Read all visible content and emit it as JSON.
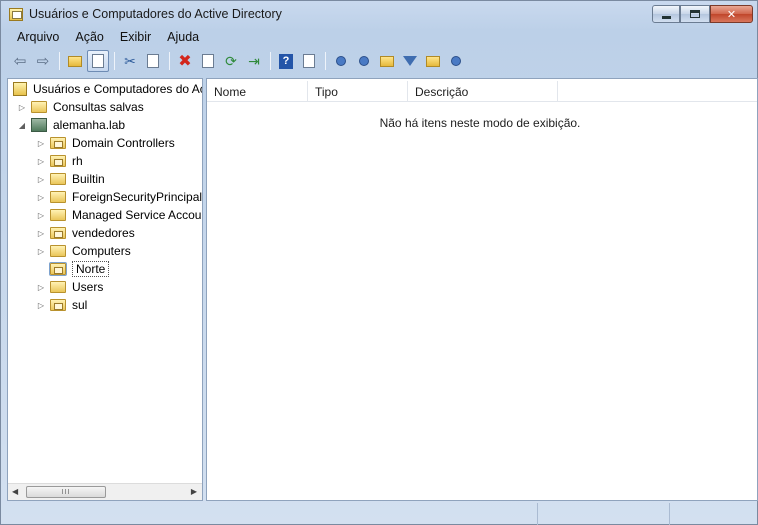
{
  "window": {
    "title": "Usuários e Computadores do Active Directory",
    "controls": [
      "minimize",
      "maximize",
      "close"
    ]
  },
  "menu": {
    "items": [
      "Arquivo",
      "Ação",
      "Exibir",
      "Ajuda"
    ]
  },
  "toolbar": {
    "icons": [
      "back-icon",
      "forward-icon",
      "up-folder-icon",
      "show-hide-tree-icon",
      "cut-icon",
      "paste-icon",
      "delete-icon",
      "properties-icon",
      "refresh-icon",
      "export-icon",
      "help-icon",
      "console-icon",
      "new-user-icon",
      "new-group-icon",
      "new-ou-icon",
      "filter-icon",
      "find-icon",
      "delegate-icon"
    ]
  },
  "tree": {
    "root": "Usuários e Computadores do Active Directory",
    "saved_queries": "Consultas salvas",
    "domain": "alemanha.lab",
    "children": [
      {
        "label": "Domain Controllers",
        "type": "ou",
        "expandable": true
      },
      {
        "label": "rh",
        "type": "ou",
        "expandable": true
      },
      {
        "label": "Builtin",
        "type": "folder",
        "expandable": true
      },
      {
        "label": "ForeignSecurityPrincipals",
        "type": "folder",
        "expandable": true
      },
      {
        "label": "Managed Service Accounts",
        "type": "folder",
        "expandable": true
      },
      {
        "label": "vendedores",
        "type": "ou",
        "expandable": true
      },
      {
        "label": "Computers",
        "type": "folder",
        "expandable": true
      },
      {
        "label": "Norte",
        "type": "ou",
        "expandable": false,
        "selected": true
      },
      {
        "label": "Users",
        "type": "folder",
        "expandable": true
      },
      {
        "label": "sul",
        "type": "ou",
        "expandable": true
      }
    ]
  },
  "list": {
    "columns": [
      "Nome",
      "Tipo",
      "Descrição"
    ],
    "empty_message": "Não há itens neste modo de exibição."
  },
  "scrollbar": {
    "grip": "III"
  }
}
